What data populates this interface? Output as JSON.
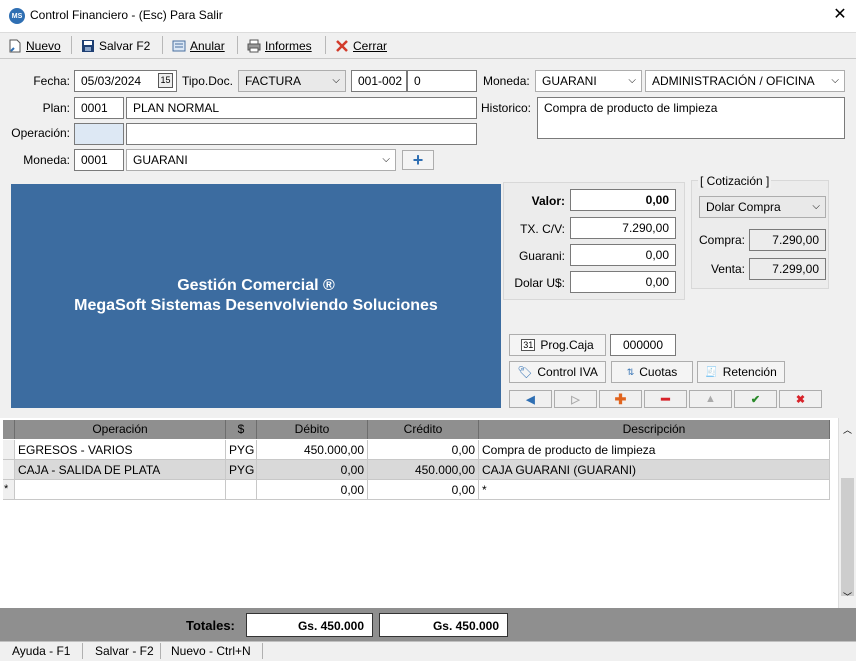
{
  "window": {
    "title": "Control Financiero  -  (Esc) Para Salir",
    "logo_text": "MS"
  },
  "toolbar": {
    "nuevo": "Nuevo",
    "salvar": "Salvar F2",
    "anular": "Anular",
    "informes": "Informes",
    "cerrar": "Cerrar"
  },
  "form": {
    "fecha_label": "Fecha:",
    "fecha_value": "05/03/2024",
    "tipodoc_label": "Tipo.Doc.",
    "tipodoc_value": "FACTURA",
    "doc_series": "001-002",
    "doc_number": "0",
    "moneda_top_label": "Moneda:",
    "moneda_top_value": "GUARANI",
    "category_value": "ADMINISTRACIÓN / OFICINA",
    "plan_label": "Plan:",
    "plan_code": "0001",
    "plan_name": "PLAN NORMAL",
    "historico_label": "Historico:",
    "historico_value": "Compra de producto de limpieza",
    "operacion_label": "Operación:",
    "operacion_code": "",
    "operacion_name": "",
    "moneda_label": "Moneda:",
    "moneda_code": "0001",
    "moneda_value": "GUARANI"
  },
  "banner": {
    "line1": "Gestión Comercial ®",
    "line2": "MegaSoft Sistemas Desenvolviendo Soluciones"
  },
  "values": {
    "valor_label": "Valor:",
    "valor": "0,00",
    "tx_label": "TX. C/V:",
    "tx": "7.290,00",
    "guarani_label": "Guarani:",
    "guarani": "0,00",
    "dolar_label": "Dolar U$:",
    "dolar": "0,00"
  },
  "cotizacion": {
    "title": "[ Cotización ]",
    "select": "Dolar Compra",
    "compra_label": "Compra:",
    "compra": "7.290,00",
    "venta_label": "Venta:",
    "venta": "7.299,00"
  },
  "actions": {
    "prog_caja": "Prog.Caja",
    "prog_caja_value": "000000",
    "control_iva": "Control IVA",
    "cuotas": "Cuotas",
    "retencion": "Retención"
  },
  "grid": {
    "headers": [
      "Operación",
      "$",
      "Débito",
      "Crédito",
      "Descripción"
    ],
    "rows": [
      [
        "EGRESOS - VARIOS",
        "PYG",
        "450.000,00",
        "0,00",
        "Compra de producto de limpieza"
      ],
      [
        "CAJA - SALIDA DE PLATA",
        "PYG",
        "0,00",
        "450.000,00",
        "CAJA GUARANI (GUARANI)"
      ],
      [
        "",
        "",
        "0,00",
        "0,00",
        "*"
      ]
    ],
    "new_row_marker": "*"
  },
  "totals": {
    "label": "Totales:",
    "debito": "Gs. 450.000",
    "credito": "Gs. 450.000"
  },
  "status": {
    "ayuda": "Ayuda - F1",
    "salvar": "Salvar - F2",
    "nuevo": "Nuevo - Ctrl+N"
  },
  "colors": {
    "banner": "#3c6ca0",
    "grid_header": "#8f8f8f",
    "accent": "#2f6fb3"
  }
}
